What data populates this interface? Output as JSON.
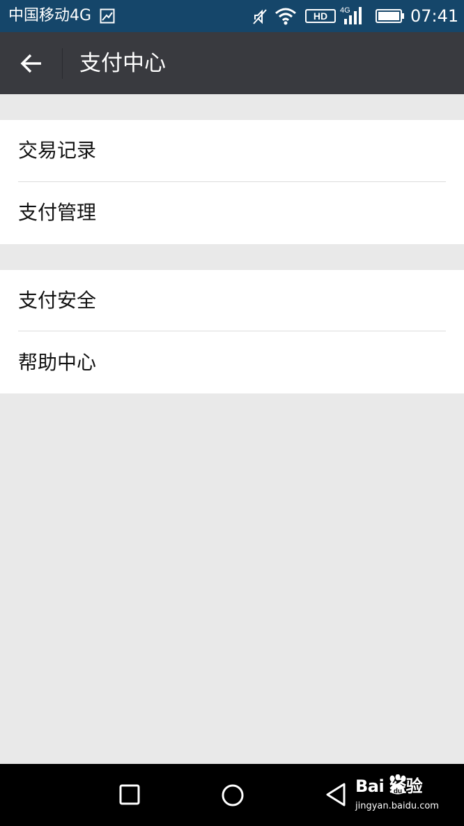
{
  "status_bar": {
    "carrier": "中国移动4G",
    "clock": "07:41",
    "icons": [
      "gallery-icon",
      "mute-icon",
      "wifi-icon",
      "hd-icon",
      "signal-4g-icon",
      "battery-icon"
    ],
    "network_badge": "4G",
    "hd_badge": "HD"
  },
  "toolbar": {
    "title": "支付中心",
    "back_icon": "arrow-left-icon"
  },
  "menu": {
    "group1": [
      {
        "label": "交易记录"
      },
      {
        "label": "支付管理"
      }
    ],
    "group2": [
      {
        "label": "支付安全"
      },
      {
        "label": "帮助中心"
      }
    ]
  },
  "nav_bar": {
    "buttons": [
      "recent-apps-icon",
      "home-icon",
      "back-triangle-icon"
    ]
  },
  "watermark": {
    "brand": "Bai  经验",
    "domain": "jingyan.baidu.com"
  },
  "colors": {
    "status_bar": "#15466a",
    "toolbar": "#393a3f",
    "background": "#e9e9e9",
    "item_bg": "#ffffff",
    "nav_bar": "#000000"
  }
}
